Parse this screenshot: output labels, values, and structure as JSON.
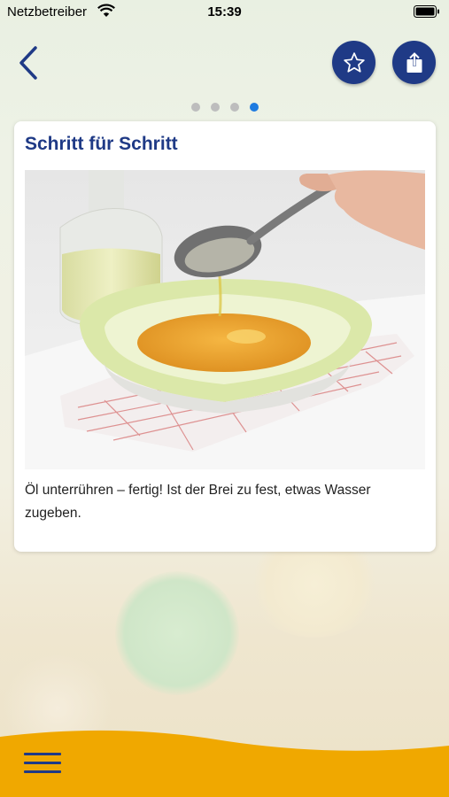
{
  "status_bar": {
    "carrier": "Netzbetreiber",
    "time": "15:39"
  },
  "header": {
    "back_icon": "chevron-left-icon",
    "favorite_icon": "star-icon",
    "share_icon": "share-icon"
  },
  "pager": {
    "total": 4,
    "active_index": 3
  },
  "card": {
    "title": "Schritt für Schritt",
    "description": "Öl unterrühren – fertig! Ist der Brei zu fest, etwas Wasser zugeben."
  },
  "footer": {
    "menu_icon": "hamburger-menu-icon"
  },
  "colors": {
    "brand_blue": "#1f3a86",
    "page_dot_active": "#1e7be0",
    "page_dot_inactive": "#bdbdbd",
    "bottom_bar": "#f0a800"
  }
}
